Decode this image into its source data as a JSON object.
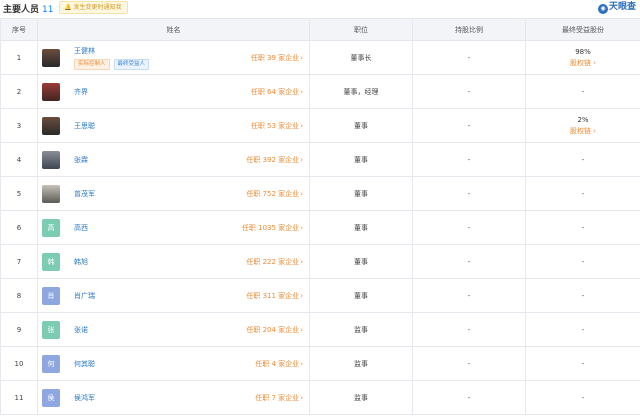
{
  "header": {
    "title": "主要人员",
    "count": "11",
    "notice": "发生变更时通知我",
    "logo_text": "天眼查"
  },
  "columns": [
    "序号",
    "姓名",
    "职位",
    "持股比例",
    "最终受益股份"
  ],
  "rows": [
    {
      "no": "1",
      "name": "王健林",
      "avatar_text": "",
      "roles": "任职 39 家企业",
      "position": "董事长",
      "share": "-",
      "benefit_pct": "98%",
      "benefit_link": "股权链",
      "tags": [
        "实际控制人",
        "最终受益人"
      ]
    },
    {
      "no": "2",
      "name": "齐界",
      "avatar_text": "",
      "roles": "任职 64 家企业",
      "position": "董事，经理",
      "share": "-",
      "benefit": "-"
    },
    {
      "no": "3",
      "name": "王思聪",
      "avatar_text": "",
      "roles": "任职 53 家企业",
      "position": "董事",
      "share": "-",
      "benefit_pct": "2%",
      "benefit_link": "股权链"
    },
    {
      "no": "4",
      "name": "张霖",
      "avatar_text": "",
      "roles": "任职 392 家企业",
      "position": "董事",
      "share": "-",
      "benefit": "-"
    },
    {
      "no": "5",
      "name": "曾茂军",
      "avatar_text": "",
      "roles": "任职 752 家企业",
      "position": "董事",
      "share": "-",
      "benefit": "-"
    },
    {
      "no": "6",
      "name": "高西",
      "avatar_text": "高",
      "roles": "任职 1035 家企业",
      "position": "董事",
      "share": "-",
      "benefit": "-"
    },
    {
      "no": "7",
      "name": "韩旭",
      "avatar_text": "韩",
      "roles": "任职 222 家企业",
      "position": "董事",
      "share": "-",
      "benefit": "-"
    },
    {
      "no": "8",
      "name": "肖广瑞",
      "avatar_text": "肖",
      "roles": "任职 311 家企业",
      "position": "董事",
      "share": "-",
      "benefit": "-"
    },
    {
      "no": "9",
      "name": "张诺",
      "avatar_text": "张",
      "roles": "任职 204 家企业",
      "position": "监事",
      "share": "-",
      "benefit": "-"
    },
    {
      "no": "10",
      "name": "何其聪",
      "avatar_text": "何",
      "roles": "任职 4 家企业",
      "position": "监事",
      "share": "-",
      "benefit": "-"
    },
    {
      "no": "11",
      "name": "侯鸿军",
      "avatar_text": "侯",
      "roles": "任职 7 家企业",
      "position": "监事",
      "share": "-",
      "benefit": "-"
    }
  ],
  "colors": {
    "accent": "#0084ff",
    "link": "#2a78c5",
    "orange": "#ef8a33",
    "header_bg": "#f2f4f8"
  }
}
